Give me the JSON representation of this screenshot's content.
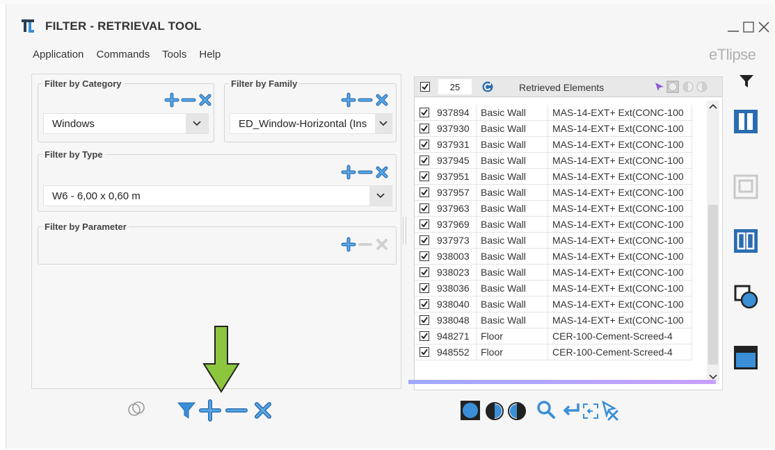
{
  "window": {
    "title": "FILTER - RETRIEVAL TOOL"
  },
  "menu": [
    "Application",
    "Commands",
    "Tools",
    "Help"
  ],
  "logo": "eTlipse",
  "category": {
    "legend": "Filter by Category",
    "value": "Windows"
  },
  "family": {
    "legend": "Filter by Family",
    "value": "ED_Window-Horizontal (Ins"
  },
  "type": {
    "legend": "Filter by Type",
    "value": "W6 - 6,00 x 0,60 m"
  },
  "parameter": {
    "legend": "Filter by Parameter"
  },
  "retrieved": {
    "count": "25",
    "title": "Retrieved Elements",
    "rows": [
      {
        "id": "937894",
        "category": "Basic Wall",
        "type": "MAS-14-EXT+ Ext(CONC-100"
      },
      {
        "id": "937930",
        "category": "Basic Wall",
        "type": "MAS-14-EXT+ Ext(CONC-100"
      },
      {
        "id": "937931",
        "category": "Basic Wall",
        "type": "MAS-14-EXT+ Ext(CONC-100"
      },
      {
        "id": "937945",
        "category": "Basic Wall",
        "type": "MAS-14-EXT+ Ext(CONC-100"
      },
      {
        "id": "937951",
        "category": "Basic Wall",
        "type": "MAS-14-EXT+ Ext(CONC-100"
      },
      {
        "id": "937957",
        "category": "Basic Wall",
        "type": "MAS-14-EXT+ Ext(CONC-100"
      },
      {
        "id": "937963",
        "category": "Basic Wall",
        "type": "MAS-14-EXT+ Ext(CONC-100"
      },
      {
        "id": "937969",
        "category": "Basic Wall",
        "type": "MAS-14-EXT+ Ext(CONC-100"
      },
      {
        "id": "937973",
        "category": "Basic Wall",
        "type": "MAS-14-EXT+ Ext(CONC-100"
      },
      {
        "id": "938003",
        "category": "Basic Wall",
        "type": "MAS-14-EXT+ Ext(CONC-100"
      },
      {
        "id": "938023",
        "category": "Basic Wall",
        "type": "MAS-14-EXT+ Ext(CONC-100"
      },
      {
        "id": "938036",
        "category": "Basic Wall",
        "type": "MAS-14-EXT+ Ext(CONC-100"
      },
      {
        "id": "938040",
        "category": "Basic Wall",
        "type": "MAS-14-EXT+ Ext(CONC-100"
      },
      {
        "id": "938048",
        "category": "Basic Wall",
        "type": "MAS-14-EXT+ Ext(CONC-100"
      },
      {
        "id": "948271",
        "category": "Floor",
        "type": "CER-100-Cement-Screed-4"
      },
      {
        "id": "948552",
        "category": "Floor",
        "type": "CER-100-Cement-Screed-4"
      }
    ]
  },
  "colors": {
    "accent": "#3a8fd6",
    "arrow": "#8cc63f"
  }
}
